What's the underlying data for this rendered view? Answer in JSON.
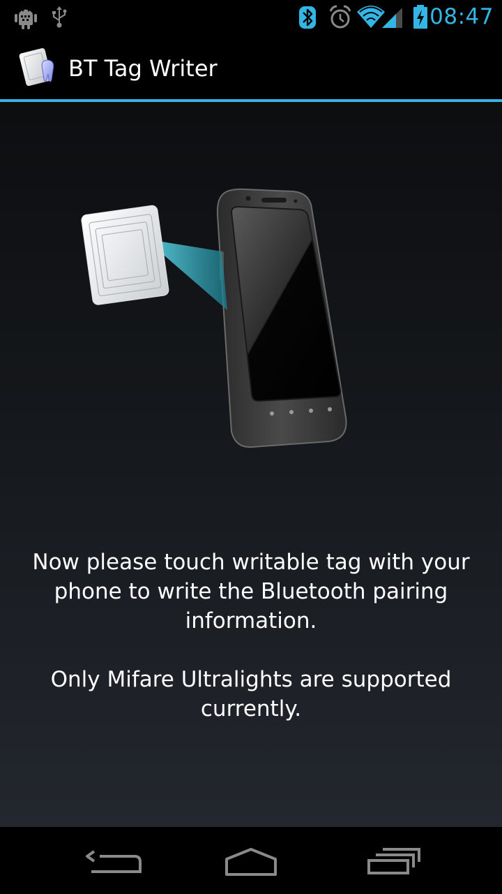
{
  "status_bar": {
    "time": "08:47",
    "left_icons": [
      "android-debug-icon",
      "usb-icon"
    ],
    "right_icons": [
      "bluetooth-icon",
      "alarm-icon",
      "wifi-icon",
      "signal-icon",
      "battery-charging-icon"
    ],
    "accent_color": "#33b5e5"
  },
  "action_bar": {
    "title": "BT Tag Writer",
    "icon": "app-icon",
    "divider_color": "#33b5e5"
  },
  "content": {
    "illustration": "nfc-tag-touch-phone-illustration",
    "message_1": "Now please touch writable tag with your phone to write the Bluetooth pairing information.",
    "message_2": "Only Mifare Ultralights are supported currently."
  },
  "nav_bar": {
    "buttons": [
      "back-icon",
      "home-icon",
      "recents-icon"
    ]
  }
}
